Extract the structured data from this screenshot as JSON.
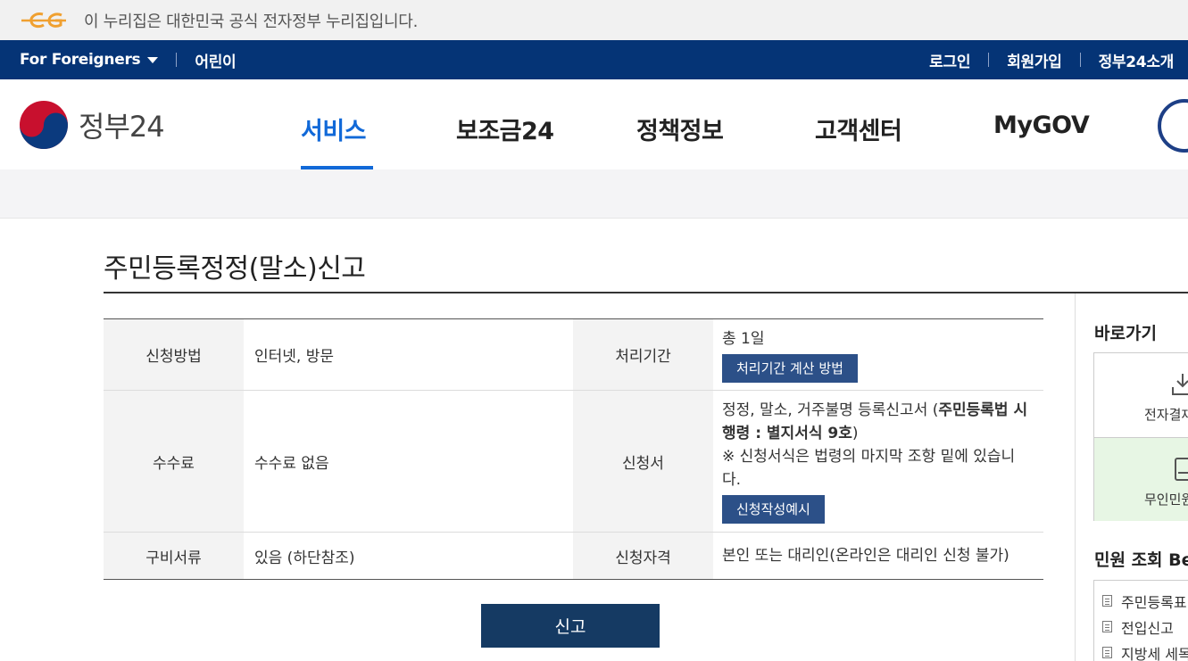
{
  "gov_banner": {
    "logo_icon": "eg-logo-icon",
    "text": "이 누리집은 대한민국 공식 전자정부 누리집입니다."
  },
  "util_bar": {
    "foreigners": "For Foreigners",
    "kids": "어린이",
    "login": "로그인",
    "signup": "회원가입",
    "about": "정부24소개"
  },
  "header": {
    "logo_text": "정부24",
    "nav": [
      {
        "label": "서비스",
        "active": true
      },
      {
        "label": "보조금24",
        "active": false
      },
      {
        "label": "정책정보",
        "active": false
      },
      {
        "label": "고객센터",
        "active": false
      },
      {
        "label": "MyGOV",
        "active": false
      }
    ]
  },
  "page": {
    "title": "주민등록정정(말소)신고"
  },
  "info_table": {
    "row1": {
      "h1": "신청방법",
      "v1": "인터넷, 방문",
      "h2": "처리기간",
      "v2": "총 1일",
      "btn": "처리기간 계산 방법"
    },
    "row2": {
      "h1": "수수료",
      "v1": "수수료 없음",
      "h2": "신청서",
      "v2_prefix": "정정, 말소, 거주불명 등록신고서 (",
      "v2_bold": "주민등록법 시행령 : 별지서식 9호",
      "v2_suffix": ")",
      "note": "※ 신청서식은 법령의 마지막 조항 밑에 있습니다.",
      "btn": "신청작성예시"
    },
    "row3": {
      "h1": "구비서류",
      "v1": "있음 (하단참조)",
      "h2": "신청자격",
      "v2": "본인 또는 대리인(온라인은 대리인 신청 불가)"
    }
  },
  "submit_button": "신고",
  "side": {
    "shortcut_title": "바로가기",
    "shortcuts": [
      {
        "label": "전자결재",
        "icon": "download-icon"
      },
      {
        "label": "무인민원",
        "icon": "kiosk-icon"
      }
    ],
    "best_title": "민원 조회 Best",
    "best": [
      "주민등록표",
      "전입신고",
      "지방세 세목"
    ]
  },
  "colors": {
    "util_bg": "#053476",
    "nav_active": "#1169d8",
    "button_dark": "#153a63",
    "mini_button": "#2c5088"
  }
}
